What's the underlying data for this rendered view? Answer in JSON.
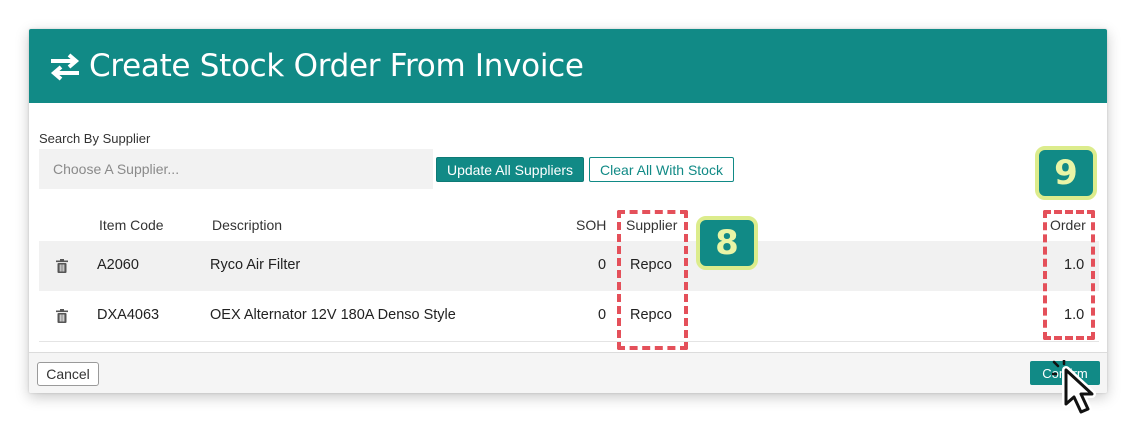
{
  "header": {
    "title": "Create Stock Order From Invoice",
    "icon": "swap-arrows-icon"
  },
  "search": {
    "label": "Search By Supplier",
    "placeholder": "Choose A Supplier..."
  },
  "actions": {
    "update_all": "Update All Suppliers",
    "clear_all": "Clear All With Stock"
  },
  "table": {
    "columns": [
      "Item Code",
      "Description",
      "SOH",
      "Supplier",
      "Order"
    ],
    "rows": [
      {
        "item_code": "A2060",
        "description": "Ryco Air Filter",
        "soh": "0",
        "supplier": "Repco",
        "order": "1.0"
      },
      {
        "item_code": "DXA4063",
        "description": "OEX Alternator 12V 180A Denso Style",
        "soh": "0",
        "supplier": "Repco",
        "order": "1.0"
      }
    ]
  },
  "footer": {
    "cancel": "Cancel",
    "confirm": "Confirm"
  },
  "annotations": {
    "badge_supplier": "8",
    "badge_order": "9"
  },
  "colors": {
    "teal": "#118a86",
    "highlight": "#e4505a",
    "badge_border": "#dcec8c"
  }
}
